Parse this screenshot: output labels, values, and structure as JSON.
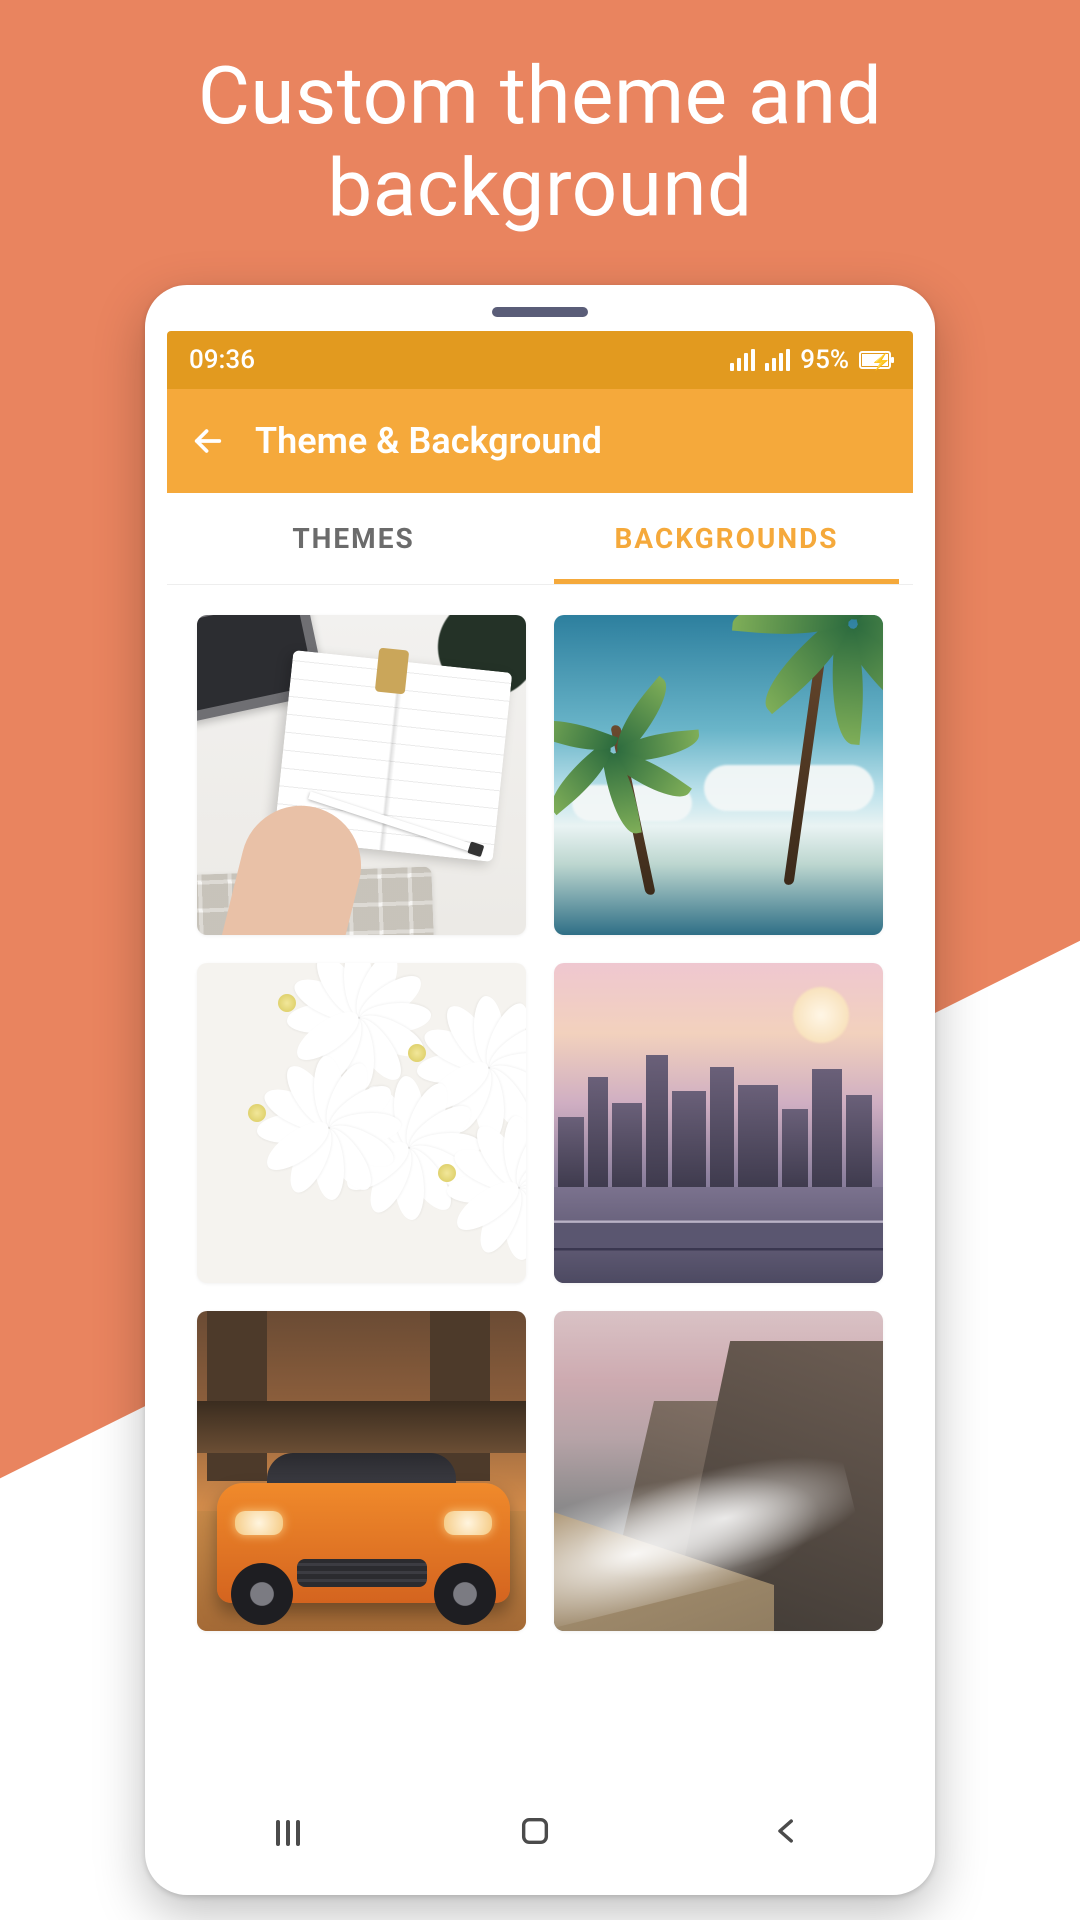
{
  "promo": {
    "title_line1": "Custom theme and",
    "title_line2": "background"
  },
  "status": {
    "time": "09:36",
    "battery_text": "95%"
  },
  "appbar": {
    "title": "Theme & Background"
  },
  "tabs": {
    "themes": "THEMES",
    "backgrounds": "BACKGROUNDS",
    "active": "backgrounds"
  },
  "tiles": [
    {
      "name": "background-desk-notebook"
    },
    {
      "name": "background-palm-trees"
    },
    {
      "name": "background-white-flowers"
    },
    {
      "name": "background-city-sunset"
    },
    {
      "name": "background-orange-car"
    },
    {
      "name": "background-coastal-cliffs"
    }
  ],
  "colors": {
    "promo_bg": "#e9845f",
    "status_bg": "#e29a1f",
    "appbar_bg": "#f5a93b",
    "accent": "#f5a93b"
  }
}
